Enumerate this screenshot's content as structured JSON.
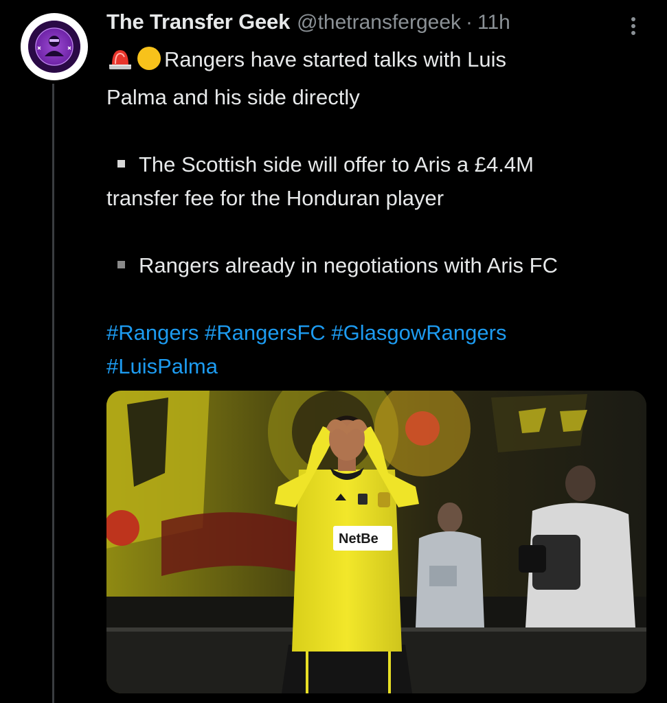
{
  "tweet": {
    "author": {
      "display_name": "The Transfer Geek",
      "handle": "@thetransfergeek",
      "separator": "·",
      "time": "11h",
      "avatar_icon": "transfer-geek-logo"
    },
    "more_icon": "more-vertical-icon",
    "text": {
      "line1": "Rangers have started talks with Luis",
      "line1_emojis": [
        "police-siren-emoji",
        "yellow-circle-emoji"
      ],
      "line2": "Palma and his side directly",
      "bullet1_line1": "The Scottish side will offer to Aris a £4.4M",
      "bullet1_line2": "transfer fee for the Honduran player",
      "bullet2": "Rangers already in negotiations with Aris FC"
    },
    "hashtags": [
      "#Rangers",
      "#RangersFC",
      "#GlasgowRangers",
      "#LuisPalma"
    ],
    "media": {
      "description_icon": "football-player-photo",
      "shirt_sponsor": "NetBe"
    }
  },
  "colors": {
    "background": "#000000",
    "text": "#e7e9ea",
    "secondary": "#8b9196",
    "link": "#1d9bf0",
    "thread_line": "#3a3d40",
    "jersey": "#f2e72a"
  }
}
